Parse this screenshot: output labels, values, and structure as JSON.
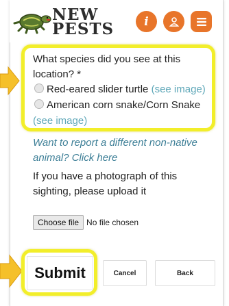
{
  "header": {
    "logo_line1": "NEW",
    "logo_line2": "PESTS",
    "info_label": "i"
  },
  "question": {
    "prompt": "What species did you see at this location? *",
    "options": [
      {
        "label": "Red-eared slider turtle",
        "link": "(see image)"
      },
      {
        "label": "American corn snake/Corn Snake",
        "link": "(see image)"
      }
    ]
  },
  "report": {
    "text": "Want to report a different non-native animal?",
    "link": "Click here"
  },
  "upload": {
    "text": "If you have a photograph of this sighting, please upload it",
    "button": "Choose file",
    "status": "No file chosen"
  },
  "footer": {
    "submit": "Submit",
    "cancel": "Cancel",
    "back": "Back"
  },
  "colors": {
    "accent": "#e8752a",
    "highlight": "#f2ee2a",
    "link": "#5ea7b8",
    "report_text": "#3c7e96",
    "arrow": "#f5c02a"
  },
  "icons": [
    "turtle-logo-icon",
    "info-icon",
    "user-icon",
    "menu-icon",
    "arrow-right-icon"
  ]
}
